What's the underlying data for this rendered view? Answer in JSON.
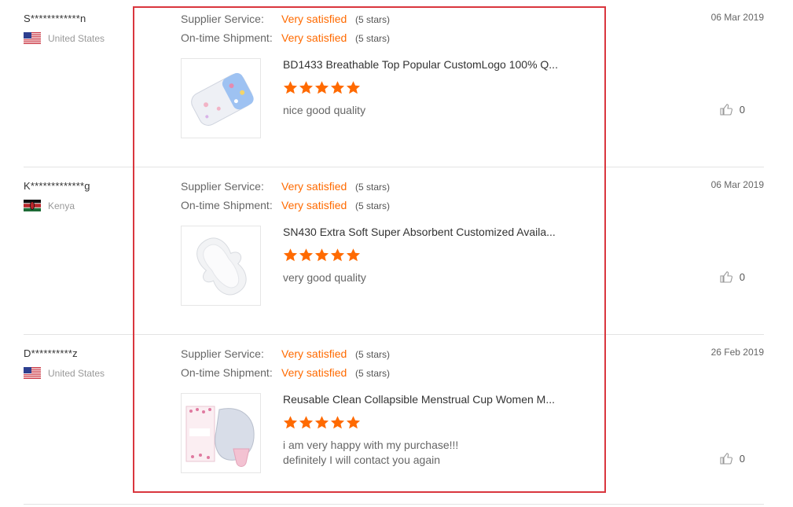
{
  "reviews": [
    {
      "buyer": "S************n",
      "country": "United States",
      "flag": "us-flag",
      "supplier_service_label": "Supplier Service:",
      "supplier_service_value": "Very satisfied",
      "supplier_service_stars": "(5 stars)",
      "shipment_label": "On-time Shipment:",
      "shipment_value": "Very satisfied",
      "shipment_stars": "(5 stars)",
      "product_title": "BD1433 Breathable Top Popular CustomLogo 100% Q...",
      "product_rating": 5,
      "comment_lines": [
        "nice good quality"
      ],
      "date": "06 Mar 2019",
      "helpful_count": "0"
    },
    {
      "buyer": "K*************g",
      "country": "Kenya",
      "flag": "kenya-flag",
      "supplier_service_label": "Supplier Service:",
      "supplier_service_value": "Very satisfied",
      "supplier_service_stars": "(5 stars)",
      "shipment_label": "On-time Shipment:",
      "shipment_value": "Very satisfied",
      "shipment_stars": "(5 stars)",
      "product_title": "SN430 Extra Soft Super Absorbent Customized Availa...",
      "product_rating": 5,
      "comment_lines": [
        "very good quality"
      ],
      "date": "06 Mar 2019",
      "helpful_count": "0"
    },
    {
      "buyer": "D**********z",
      "country": "United States",
      "flag": "us-flag",
      "supplier_service_label": "Supplier Service:",
      "supplier_service_value": "Very satisfied",
      "supplier_service_stars": "(5 stars)",
      "shipment_label": "On-time Shipment:",
      "shipment_value": "Very satisfied",
      "shipment_stars": "(5 stars)",
      "product_title": "Reusable Clean Collapsible Menstrual Cup Women M...",
      "product_rating": 5,
      "comment_lines": [
        "i am very happy with my purchase!!!",
        "definitely I will contact you again"
      ],
      "date": "26 Feb 2019",
      "helpful_count": "0"
    }
  ],
  "colors": {
    "accent": "#ff6a00",
    "highlight_border": "#d9363e"
  }
}
